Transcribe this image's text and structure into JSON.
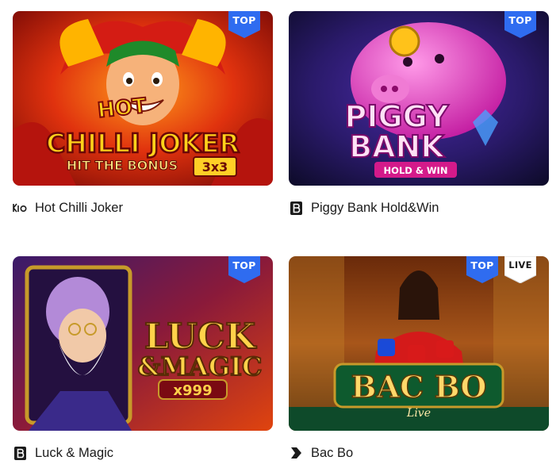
{
  "games": [
    {
      "title": "Hot Chilli Joker",
      "provider_icon": "kiron-provider-icon",
      "badges": [
        "TOP"
      ],
      "art_lines": [
        "HOT",
        "CHILLI JOKER",
        "HIT THE BONUS",
        "3x3"
      ]
    },
    {
      "title": "Piggy Bank Hold&Win",
      "provider_icon": "bgaming-provider-icon",
      "badges": [
        "TOP"
      ],
      "art_lines": [
        "PIGGY",
        "BANK",
        "HOLD & WIN"
      ]
    },
    {
      "title": "Luck & Magic",
      "provider_icon": "bgaming-provider-icon",
      "badges": [
        "TOP"
      ],
      "art_lines": [
        "LUCK",
        "&MAGIC",
        "x999"
      ]
    },
    {
      "title": "Bac Bo",
      "provider_icon": "evolution-provider-icon",
      "badges": [
        "TOP",
        "LIVE"
      ],
      "art_lines": [
        "BAC BO",
        "Live"
      ]
    }
  ],
  "colors": {
    "top_badge": "#2f6cf0",
    "live_badge": "#ffffff",
    "caption_text": "#1b1b1b"
  }
}
